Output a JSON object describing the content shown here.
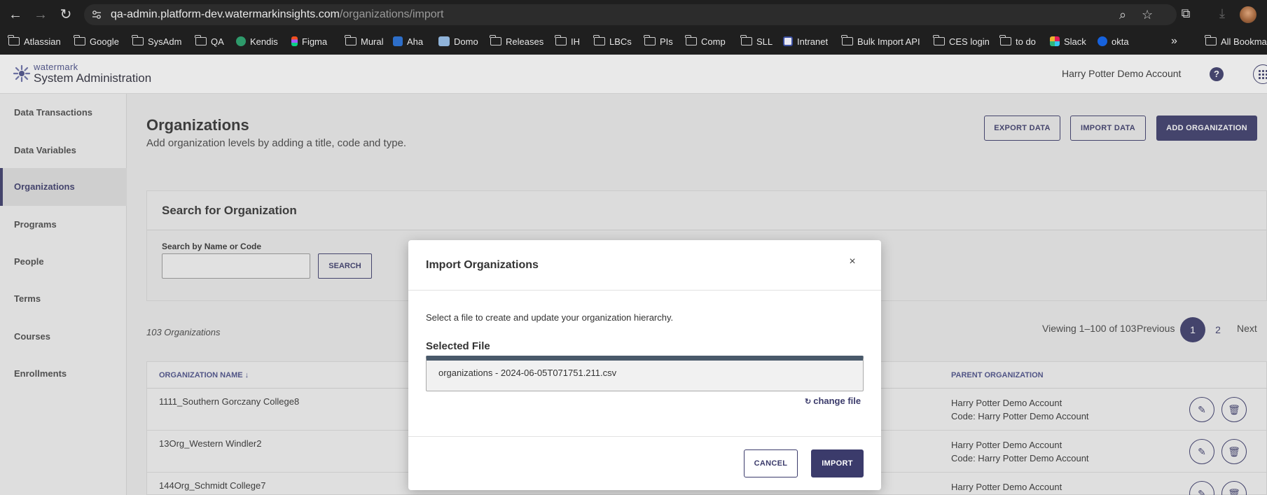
{
  "browser": {
    "url_host": "qa-admin.platform-dev.watermarkinsights.com",
    "url_path": "/organizations/import",
    "bookmarks": [
      "Atlassian",
      "Google",
      "SysAdm",
      "QA",
      "Kendis",
      "Figma",
      "Mural",
      "Aha",
      "Domo",
      "Releases",
      "IH",
      "LBCs",
      "PIs",
      "Comp",
      "SLL",
      "Intranet",
      "Bulk Import API",
      "CES login",
      "to do",
      "Slack",
      "okta"
    ],
    "overflow_label": "»",
    "all_bookmarks": "All Bookmarks"
  },
  "app": {
    "brand_small": "watermark",
    "title": "System Administration",
    "account": "Harry Potter Demo Account"
  },
  "sidebar": {
    "items": [
      "Data Transactions",
      "Data Variables",
      "Organizations",
      "Programs",
      "People",
      "Terms",
      "Courses",
      "Enrollments"
    ],
    "active": "Organizations"
  },
  "page": {
    "title": "Organizations",
    "subtitle": "Add organization levels by adding a title, code and type.",
    "export_label": "EXPORT DATA",
    "import_label": "IMPORT DATA",
    "add_label": "ADD ORGANIZATION"
  },
  "search": {
    "heading": "Search for Organization",
    "label": "Search by Name or Code",
    "value": "",
    "button": "SEARCH"
  },
  "results": {
    "count": "103 Organizations",
    "viewing": "Viewing 1–100 of 103",
    "previous": "Previous",
    "pages": [
      "1",
      "2"
    ],
    "next": "Next"
  },
  "table": {
    "columns": {
      "name": "ORGANIZATION NAME ↓",
      "parent": "PARENT ORGANIZATION"
    },
    "rows": [
      {
        "name": "1111_Southern Gorczany College8",
        "parent": "Harry Potter Demo Account",
        "parent_code": "Code: Harry Potter Demo Account"
      },
      {
        "name": "13Org_Western Windler2",
        "parent": "Harry Potter Demo Account",
        "parent_code": "Code: Harry Potter Demo Account"
      },
      {
        "name": "144Org_Schmidt College7",
        "parent": "Harry Potter Demo Account",
        "parent_code": ""
      }
    ]
  },
  "modal": {
    "title": "Import Organizations",
    "close": "×",
    "description": "Select a file to create and update your organization hierarchy.",
    "file_label": "Selected File",
    "file_name": "organizations - 2024-06-05T071751.211.csv",
    "change_file": "change file",
    "cancel": "CANCEL",
    "import": "IMPORT"
  },
  "colors": {
    "accent": "#3b3b6b",
    "chrome": "#1f1f1f",
    "file_bar": "#49596a"
  }
}
